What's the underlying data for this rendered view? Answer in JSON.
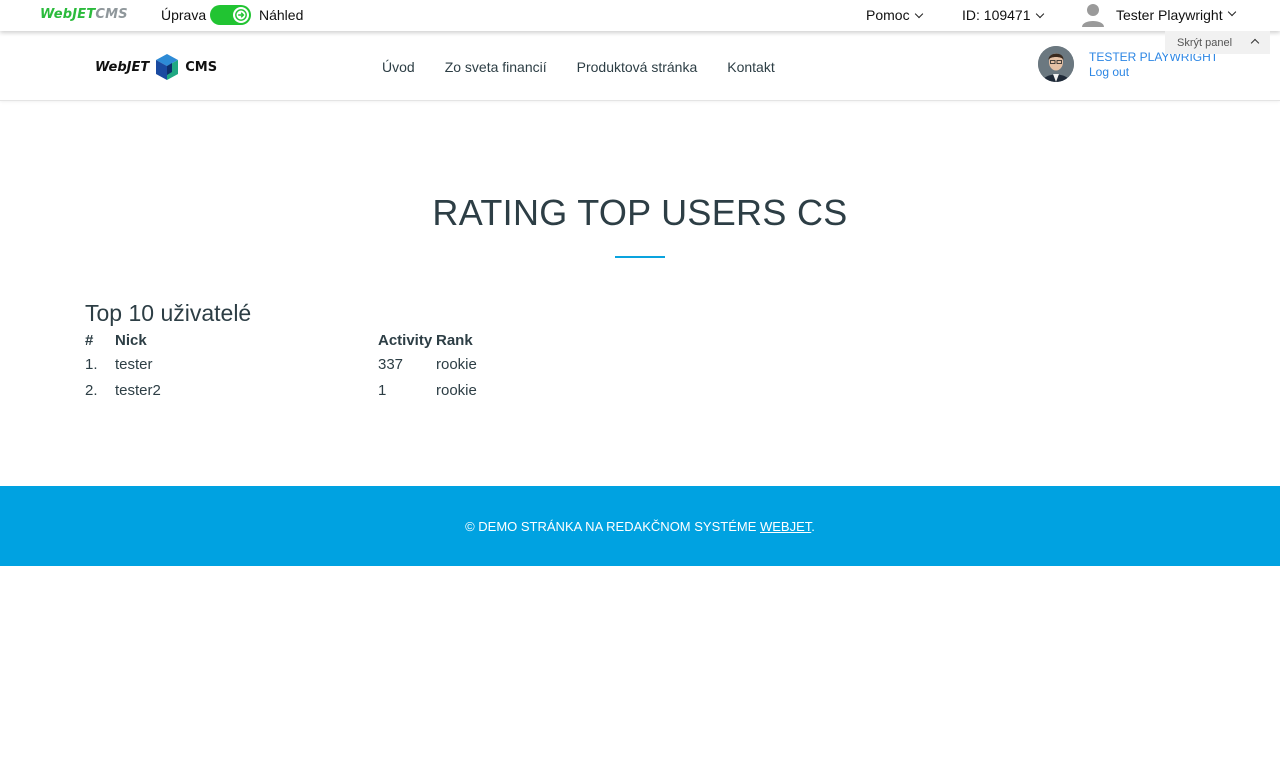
{
  "admin_bar": {
    "logo_part1": "WebJET",
    "logo_part2": "CMS",
    "mode_edit_label": "Úprava",
    "mode_preview_label": "Náhled",
    "help_label": "Pomoc",
    "doc_id_label": "ID: 109471",
    "user_name": "Tester Playwright",
    "hide_panel_label": "Skrýt panel",
    "accent_color": "#21c432"
  },
  "header": {
    "logo_text1": "WebJET",
    "logo_text2": "CMS",
    "nav": [
      {
        "label": "Úvod"
      },
      {
        "label": "Zo sveta financií"
      },
      {
        "label": "Produktová stránka"
      },
      {
        "label": "Kontakt"
      }
    ],
    "profile_name": "TESTER PLAYWRIGHT",
    "logout_label": "Log out"
  },
  "main": {
    "title": "RATING TOP USERS CS",
    "section_heading": "Top 10 uživatelé",
    "table": {
      "columns": [
        "#",
        "Nick",
        "Activity",
        "Rank"
      ],
      "rows": [
        {
          "num": "1.",
          "nick": "tester",
          "activity": "337",
          "rank": "rookie"
        },
        {
          "num": "2.",
          "nick": "tester2",
          "activity": "1",
          "rank": "rookie"
        }
      ]
    }
  },
  "footer": {
    "text": "© DEMO STRÁNKA NA REDAKČNOM SYSTÉME ",
    "link_label": "WEBJET",
    "suffix": ".",
    "color": "#00a2e1"
  }
}
